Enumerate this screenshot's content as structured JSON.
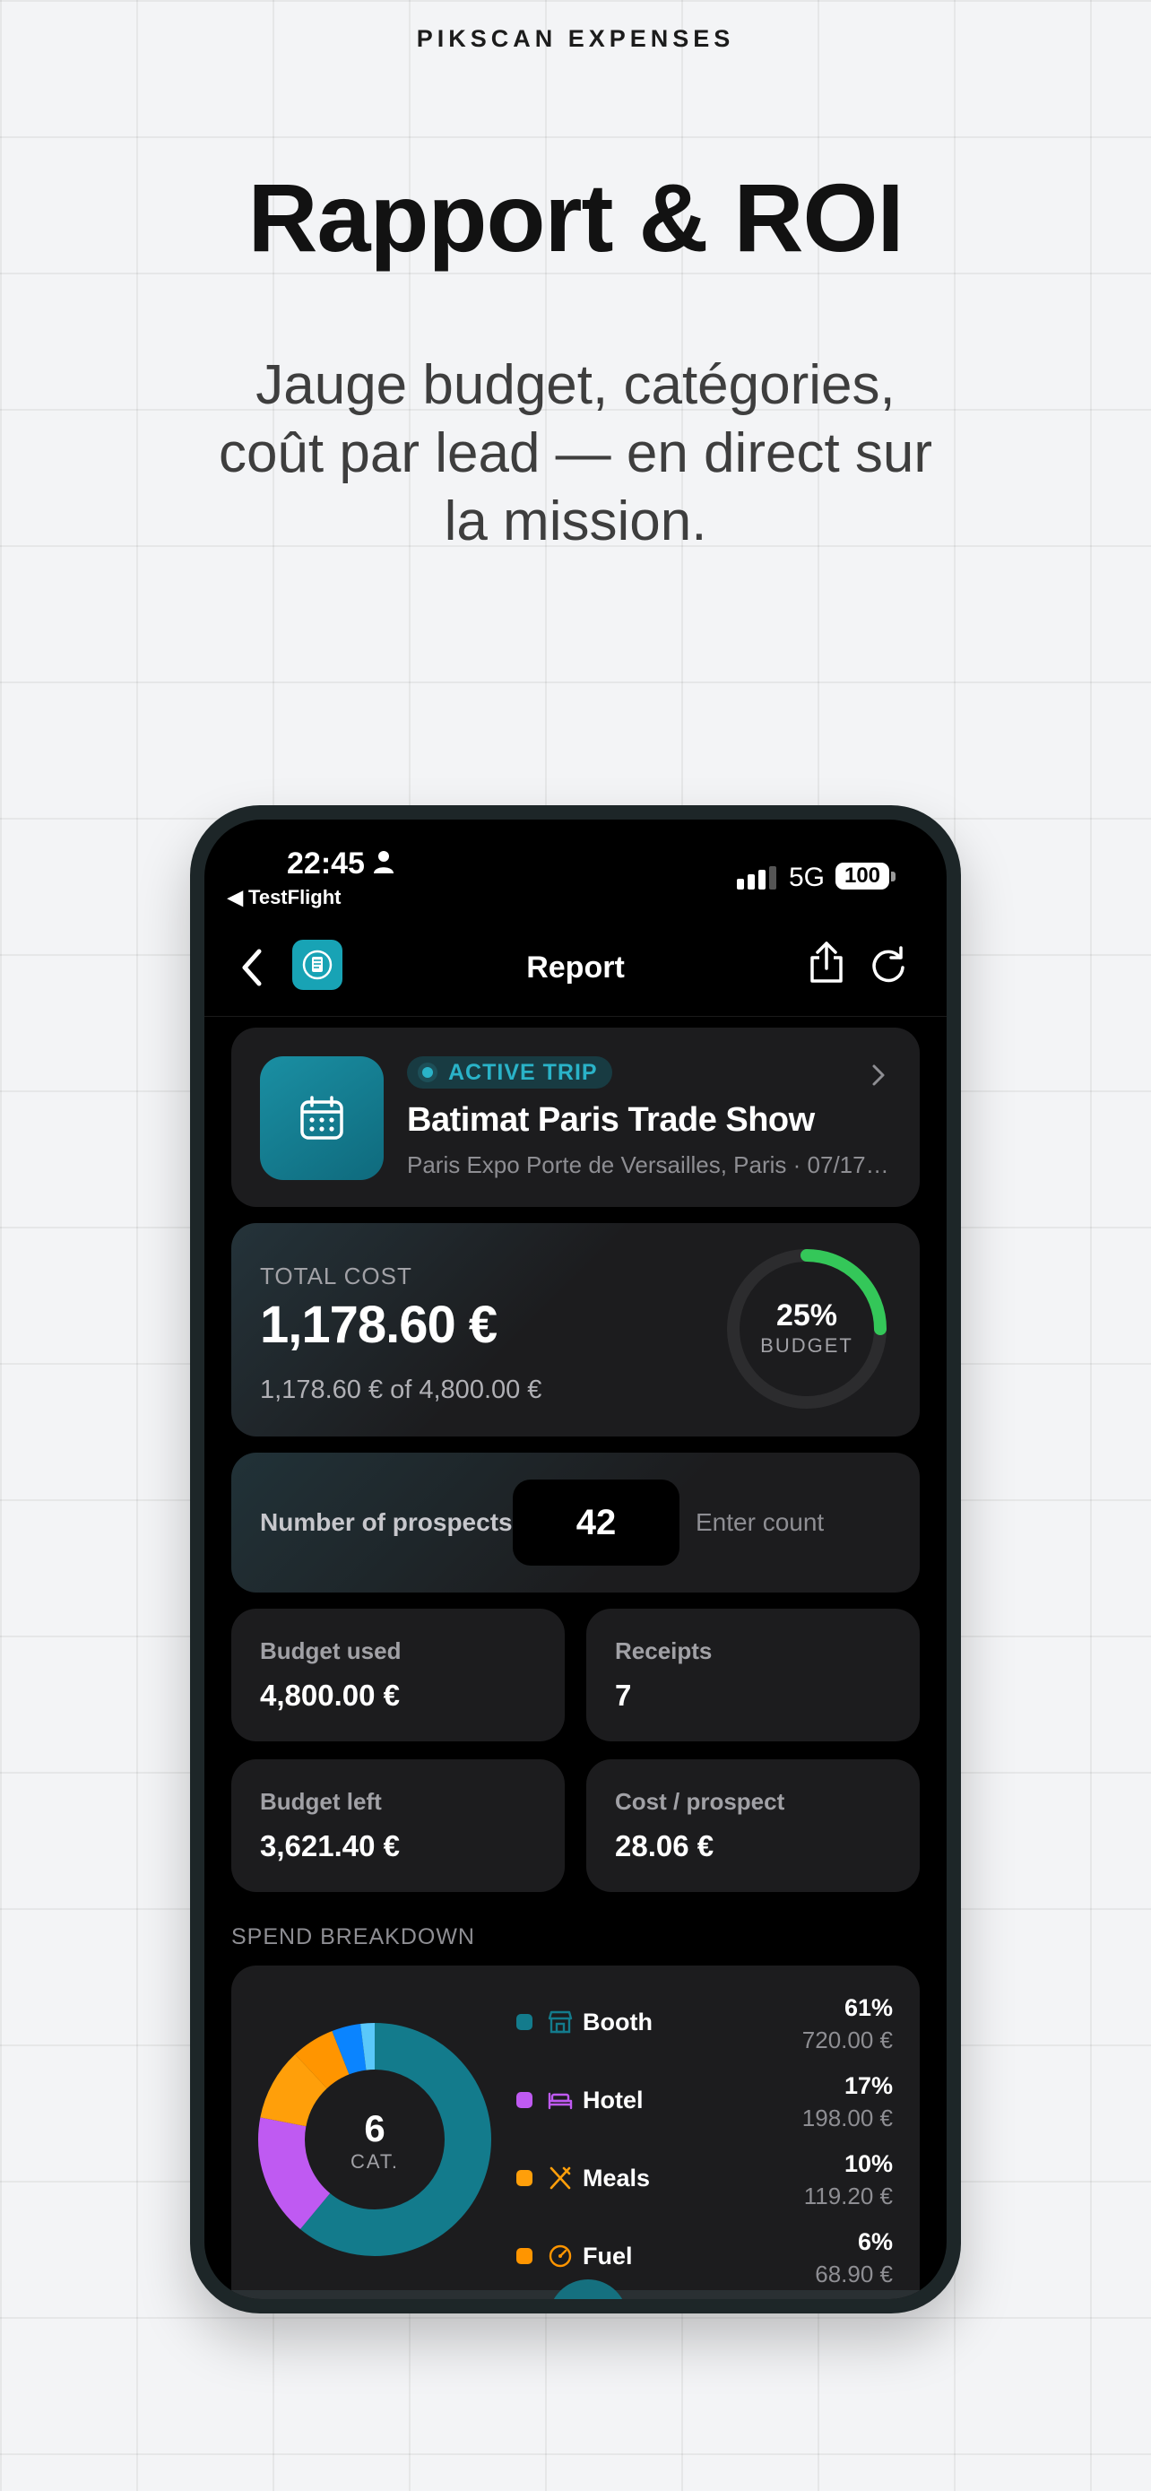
{
  "page": {
    "brand": "PIKSCAN EXPENSES",
    "headline": "Rapport & ROI",
    "subtitle": "Jauge budget, catégories, coût par lead — en direct sur la mission."
  },
  "status_bar": {
    "time": "22:45",
    "back_app": "◀ TestFlight",
    "network": "5G",
    "battery": "100"
  },
  "navbar": {
    "title": "Report"
  },
  "trip": {
    "badge": "ACTIVE TRIP",
    "name": "Batimat Paris Trade Show",
    "place": "Paris Expo Porte de Versailles, Paris · 07/17/..."
  },
  "total_cost": {
    "label": "TOTAL COST",
    "amount": "1,178.60 €",
    "sub": "1,178.60 € of 4,800.00 €",
    "gauge_percent": "25%",
    "gauge_label": "BUDGET",
    "gauge_fraction": 0.25,
    "gauge_color": "#34c759"
  },
  "prospects": {
    "label": "Number of prospects",
    "value": "42",
    "placeholder": "Enter count"
  },
  "stats": [
    {
      "label": "Budget used",
      "value": "4,800.00 €"
    },
    {
      "label": "Receipts",
      "value": "7"
    },
    {
      "label": "Budget left",
      "value": "3,621.40 €"
    },
    {
      "label": "Cost / prospect",
      "value": "28.06 €"
    }
  ],
  "breakdown": {
    "section_title": "SPEND BREAKDOWN",
    "count": "6",
    "count_label": "CAT.",
    "categories": [
      {
        "name": "Booth",
        "percent": "61%",
        "amount": "720.00 €",
        "color": "#137b8c",
        "icon": "storefront-icon"
      },
      {
        "name": "Hotel",
        "percent": "17%",
        "amount": "198.00 €",
        "color": "#bf5af2",
        "icon": "bed-icon"
      },
      {
        "name": "Meals",
        "percent": "10%",
        "amount": "119.20 €",
        "color": "#ff9f0a",
        "icon": "utensils-icon"
      },
      {
        "name": "Fuel",
        "percent": "6%",
        "amount": "68.90 €",
        "color": "#ff9500",
        "icon": "gauge-icon"
      }
    ],
    "donut_segments": [
      {
        "value": 61,
        "color": "#137b8c"
      },
      {
        "value": 17,
        "color": "#bf5af2"
      },
      {
        "value": 10,
        "color": "#ff9f0a"
      },
      {
        "value": 6,
        "color": "#ff9500"
      },
      {
        "value": 4,
        "color": "#0a84ff"
      },
      {
        "value": 2,
        "color": "#5ac8fa"
      }
    ]
  }
}
